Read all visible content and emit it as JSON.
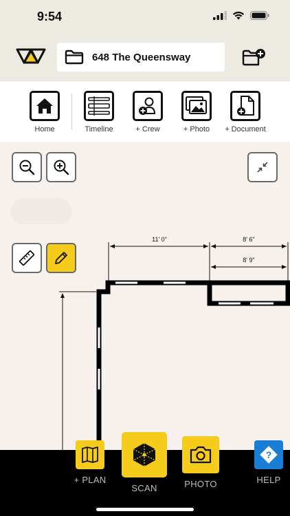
{
  "status_bar": {
    "time": "9:54"
  },
  "header": {
    "project_name": "648 The Queensway"
  },
  "toolbar": {
    "items": [
      {
        "label": "Home"
      },
      {
        "label": "Timeline"
      },
      {
        "label": "+ Crew"
      },
      {
        "label": "+ Photo"
      },
      {
        "label": "+ Document"
      }
    ]
  },
  "floorplan": {
    "dimensions": [
      "11' 0\"",
      "8' 6\"",
      "8' 9\""
    ]
  },
  "bottom_nav": {
    "items": [
      {
        "label": "+ PLAN"
      },
      {
        "label": "SCAN"
      },
      {
        "label": "PHOTO"
      },
      {
        "label": "HELP"
      }
    ]
  },
  "colors": {
    "accent_yellow": "#f5cb1c",
    "help_blue": "#1a7fd4",
    "header_bg": "#eceae1",
    "canvas_bg": "#f6f1ec"
  }
}
